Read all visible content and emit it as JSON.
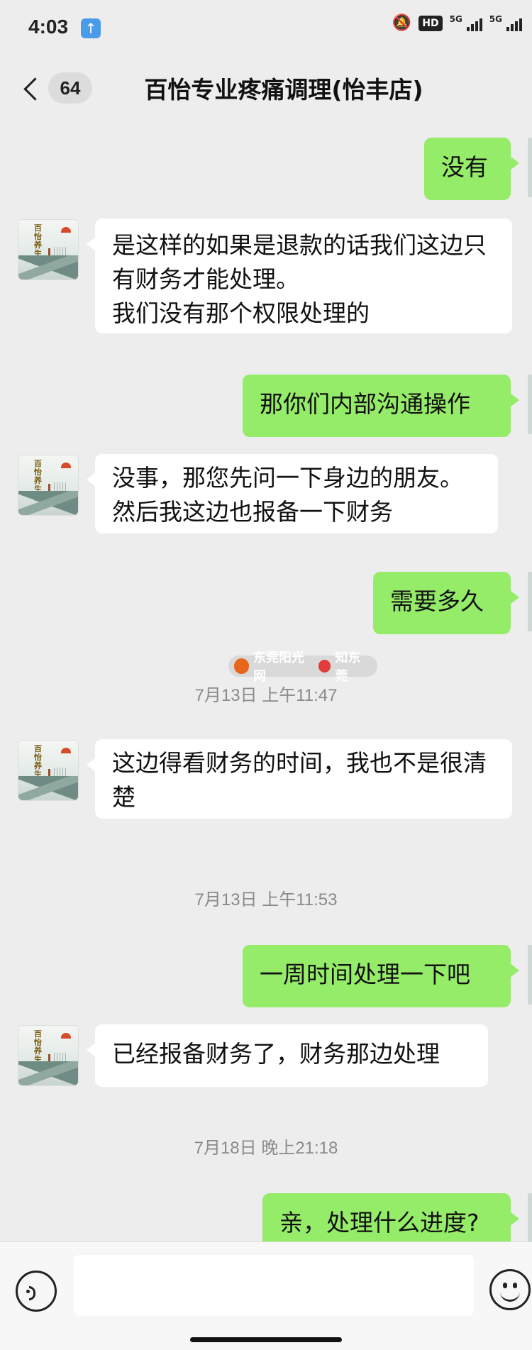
{
  "status_bar": {
    "time": "4:03",
    "network": "5G",
    "hd": "HD"
  },
  "header": {
    "unread_count": "64",
    "title": "百怡专业疼痛调理(怡丰店)"
  },
  "contact_avatar_text": "百怡养生馆",
  "messages": [
    {
      "type": "outgoing",
      "text": "没有"
    },
    {
      "type": "incoming",
      "text": "是这样的如果是退款的话我们这边只有财务才能处理。\n我们没有那个权限处理的"
    },
    {
      "type": "outgoing",
      "text": "那你们内部沟通操作"
    },
    {
      "type": "incoming",
      "text": "没事，那您先问一下身边的朋友。然后我这边也报备一下财务"
    },
    {
      "type": "outgoing",
      "text": "需要多久"
    },
    {
      "type": "timestamp",
      "text": "7月13日 上午11:47"
    },
    {
      "type": "incoming",
      "text": "这边得看财务的时间，我也不是很清楚"
    },
    {
      "type": "timestamp",
      "text": "7月13日 上午11:53"
    },
    {
      "type": "outgoing",
      "text": "一周时间处理一下吧"
    },
    {
      "type": "incoming",
      "text": "已经报备财务了，财务那边处理"
    },
    {
      "type": "timestamp",
      "text": "7月18日 晚上21:18"
    },
    {
      "type": "outgoing",
      "text": "亲，处理什么进度?"
    }
  ],
  "watermark": {
    "source": "东莞阳光网",
    "brand": "知东莞"
  },
  "input_bar": {
    "placeholder": ""
  }
}
